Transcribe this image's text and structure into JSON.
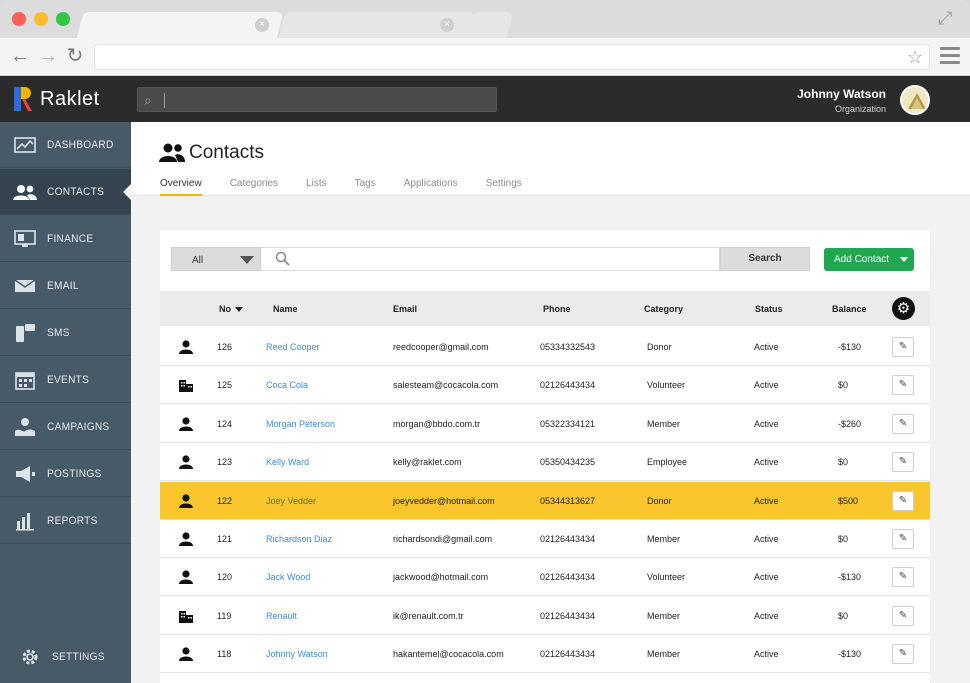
{
  "app": {
    "name": "Raklet",
    "brand_color": "#f4b400",
    "accent_blue": "#2d6bd6"
  },
  "user": {
    "name": "Johnny Watson",
    "role": "Organization"
  },
  "sidebar": {
    "items": [
      {
        "label": "DASHBOARD",
        "icon": "dashboard-icon"
      },
      {
        "label": "CONTACTS",
        "icon": "contacts-icon",
        "active": true
      },
      {
        "label": "FINANCE",
        "icon": "finance-icon"
      },
      {
        "label": "EMAIL",
        "icon": "email-icon"
      },
      {
        "label": "SMS",
        "icon": "sms-icon"
      },
      {
        "label": "EVENTS",
        "icon": "events-icon"
      },
      {
        "label": "CAMPAIGNS",
        "icon": "campaigns-icon"
      },
      {
        "label": "POSTINGS",
        "icon": "postings-icon"
      },
      {
        "label": "REPORTS",
        "icon": "reports-icon"
      }
    ],
    "settings_label": "SETTINGS"
  },
  "page": {
    "title": "Contacts",
    "tabs": [
      "Overview",
      "Categories",
      "Lists",
      "Tags",
      "Applications",
      "Settings"
    ],
    "active_tab": "Overview"
  },
  "filter": {
    "selected": "All",
    "search_button": "Search",
    "add_button": "Add Contact"
  },
  "table": {
    "columns": {
      "no": "No",
      "name": "Name",
      "email": "Email",
      "phone": "Phone",
      "category": "Category",
      "status": "Status",
      "balance": "Balance"
    },
    "rows": [
      {
        "type": "person",
        "no": "126",
        "name": "Reed Cooper",
        "email": "reedcooper@gmail.com",
        "phone": "05334332543",
        "category": "Donor",
        "status": "Active",
        "balance": "-$130"
      },
      {
        "type": "organization",
        "no": "125",
        "name": "Coca Cola",
        "email": "salesteam@cocacola.com",
        "phone": "02126443434",
        "category": "Volunteer",
        "status": "Active",
        "balance": "$0"
      },
      {
        "type": "person",
        "no": "124",
        "name": "Morgan Peterson",
        "email": "morgan@bbdo.com.tr",
        "phone": "05322334121",
        "category": "Member",
        "status": "Active",
        "balance": "-$260"
      },
      {
        "type": "person",
        "no": "123",
        "name": "Kelly Ward",
        "email": "kelly@raklet.com",
        "phone": "05350434235",
        "category": "Employee",
        "status": "Active",
        "balance": "$0"
      },
      {
        "type": "person",
        "no": "122",
        "name": "Joey Vedder",
        "email": "joeyvedder@hotmail.com",
        "phone": "05344313627",
        "category": "Donor",
        "status": "Active",
        "balance": "$500",
        "highlight": true
      },
      {
        "type": "person",
        "no": "121",
        "name": "Richardson Diaz",
        "email": "richardsondi@gmail.com",
        "phone": "02126443434",
        "category": "Member",
        "status": "Active",
        "balance": "$0"
      },
      {
        "type": "person",
        "no": "120",
        "name": "Jack Wood",
        "email": "jackwood@hotmail.com",
        "phone": "02126443434",
        "category": "Volunteer",
        "status": "Active",
        "balance": "-$130"
      },
      {
        "type": "organization",
        "no": "119",
        "name": "Renault",
        "email": "ik@renault.com.tr",
        "phone": "02126443434",
        "category": "Member",
        "status": "Active",
        "balance": "$0"
      },
      {
        "type": "person",
        "no": "118",
        "name": "Johnny Watson",
        "email": "hakantemel@cocacola.com",
        "phone": "02126443434",
        "category": "Member",
        "status": "Active",
        "balance": "-$130"
      }
    ]
  }
}
